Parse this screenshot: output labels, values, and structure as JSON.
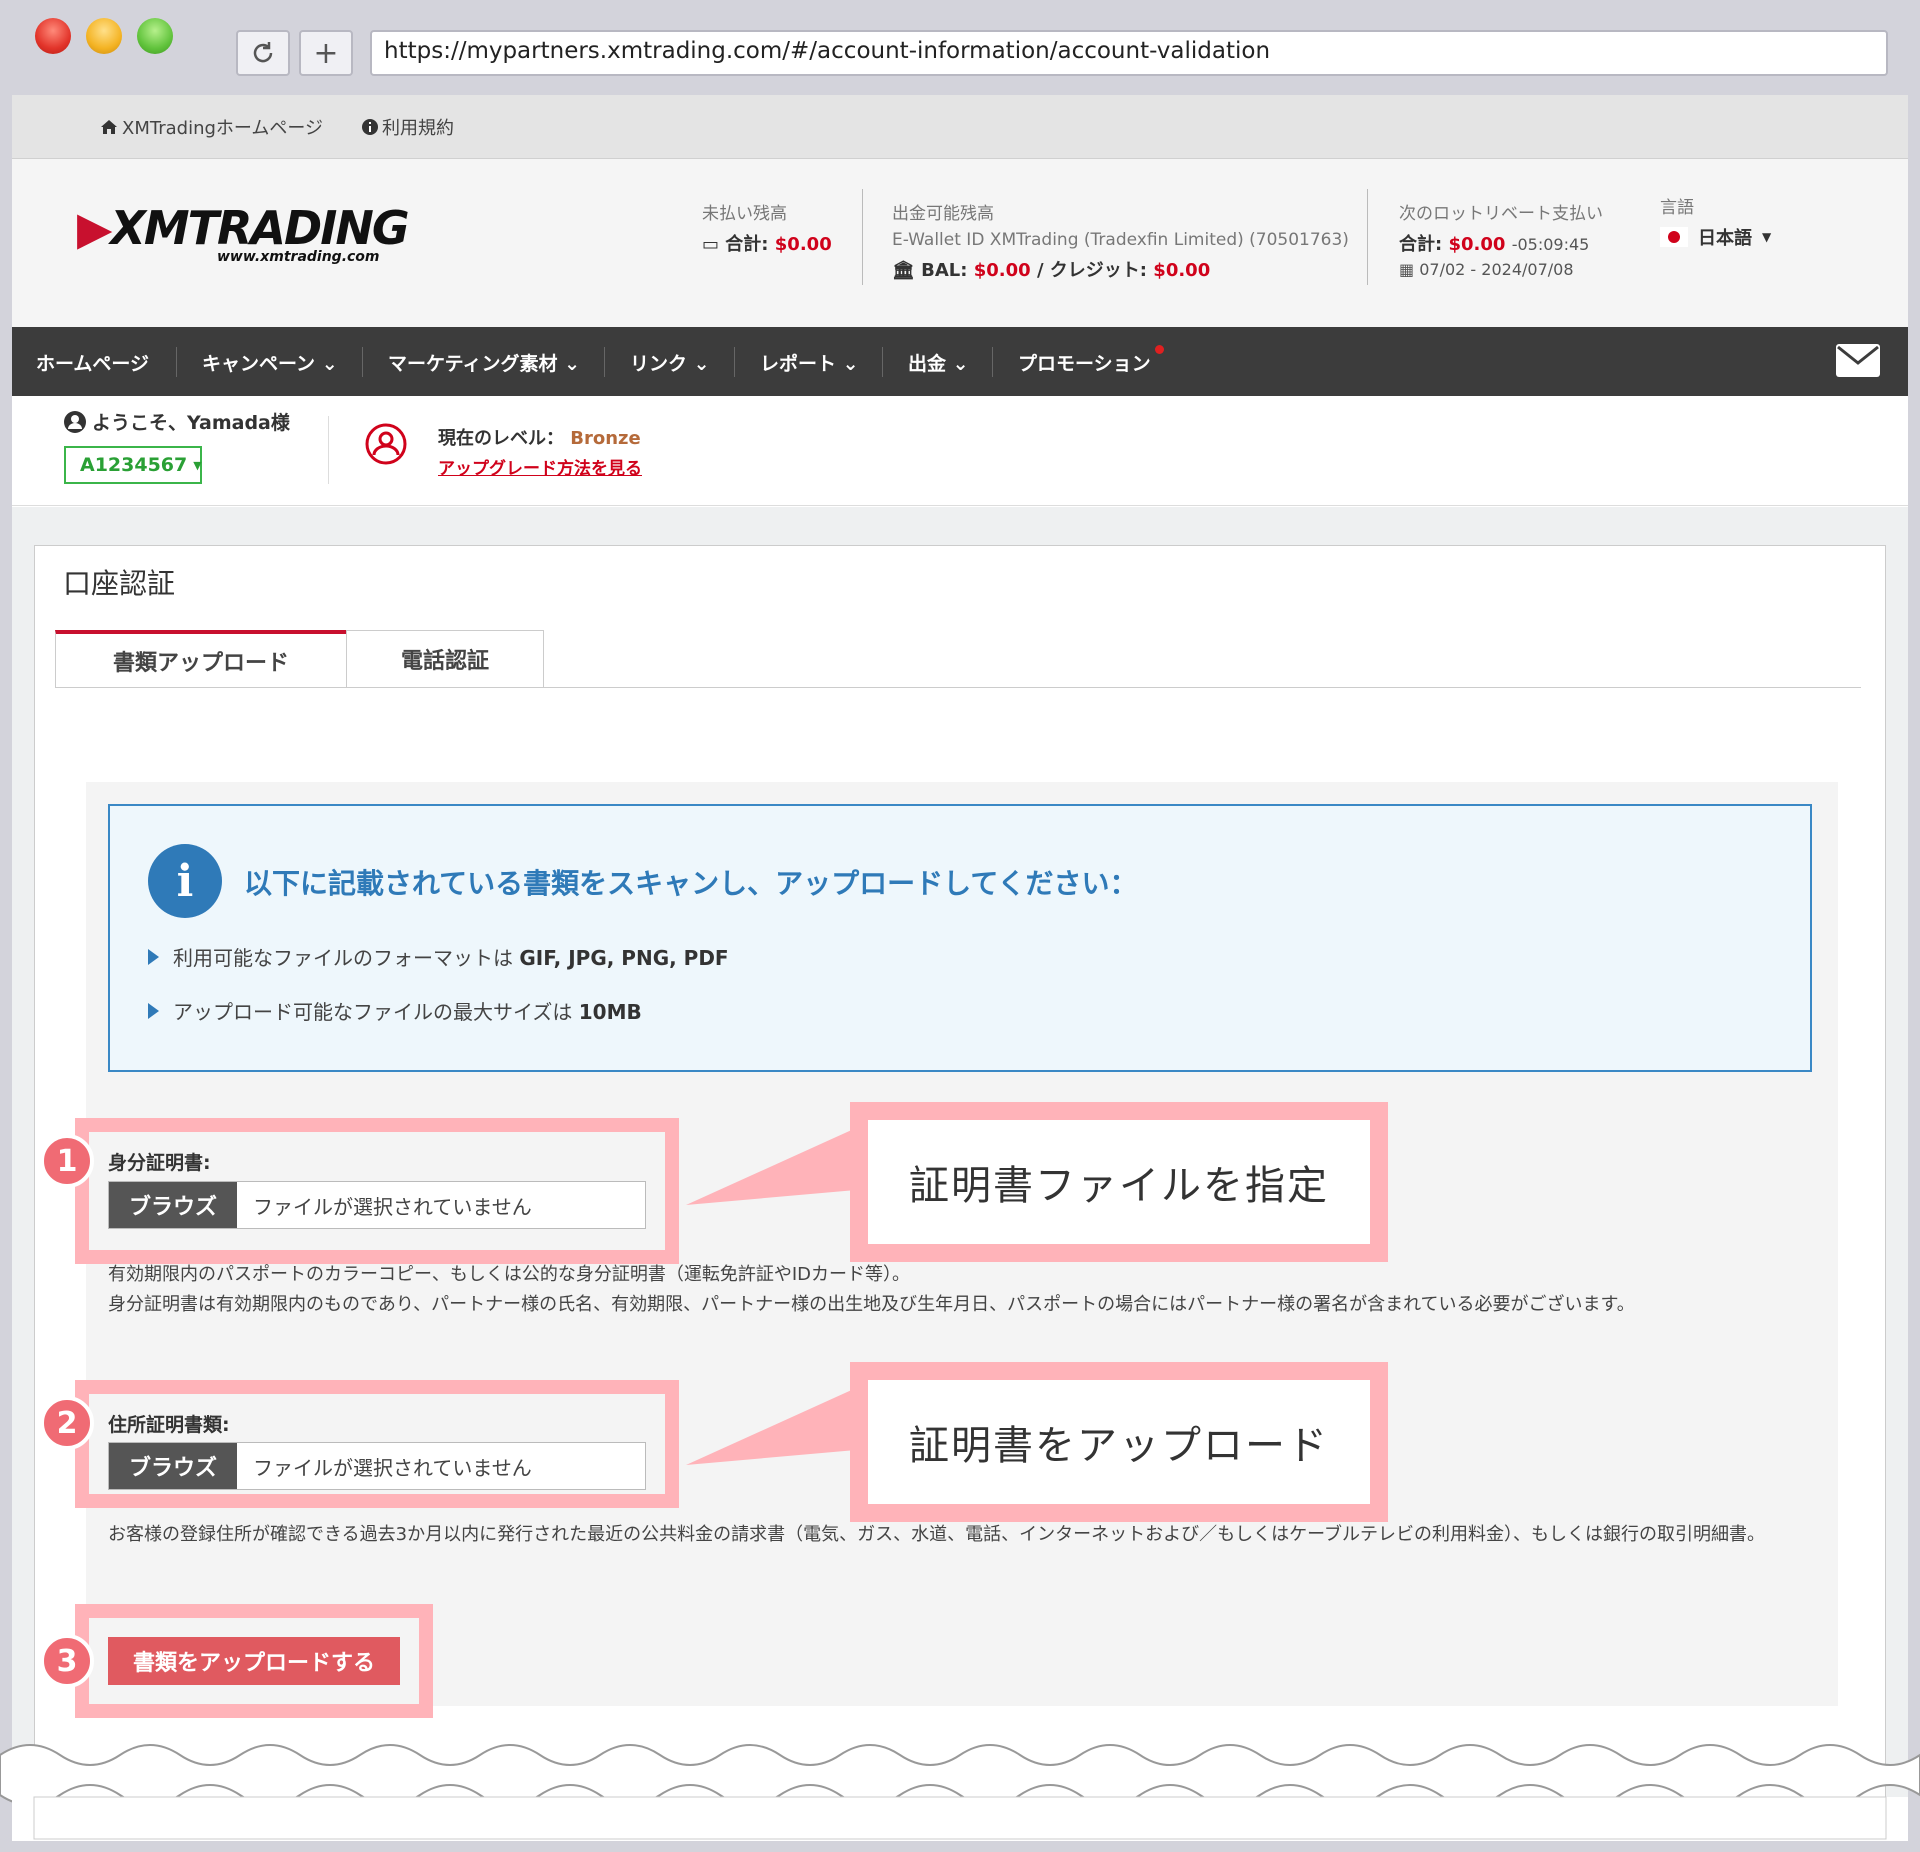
{
  "browser": {
    "url": "https://mypartners.xmtrading.com/#/account-information/account-validation"
  },
  "topbar": {
    "home_link": "XMTradingホームページ",
    "terms_link": "利用規約"
  },
  "header": {
    "logo_text": "XMTRADING",
    "logo_sub": "www.xmtrading.com",
    "unpaid": {
      "label": "未払い残高",
      "total_label": "合計:",
      "total_value": "$0.00"
    },
    "withdrawable": {
      "label": "出金可能残高",
      "wallet": "E-Wallet ID XMTrading (Tradexfin Limited) (70501763)",
      "bal_label": "BAL:",
      "bal_value": "$0.00",
      "credit_label": "/ クレジット:",
      "credit_value": "$0.00"
    },
    "rebate": {
      "label": "次のロットリベート支払い",
      "total_label": "合計:",
      "total_value": "$0.00",
      "countdown": "-05:09:45",
      "period": "07/02 - 2024/07/08"
    },
    "language": {
      "label": "言語",
      "value": "日本語"
    }
  },
  "nav": {
    "items": [
      "ホームページ",
      "キャンペーン",
      "マーケティング素材",
      "リンク",
      "レポート",
      "出金",
      "プロモーション"
    ]
  },
  "welcome": {
    "greeting": "ようこそ、Yamada様",
    "account_id": "A1234567",
    "level_label": "現在のレベル：",
    "level_value": "Bronze",
    "upgrade_link": "アップグレード方法を見る"
  },
  "panel": {
    "title": "口座認証",
    "tabs": [
      "書類アップロード",
      "電話認証"
    ],
    "info": {
      "title": "以下に記載されている書類をスキャンし、アップロードしてください：",
      "formats_text": "利用可能なファイルのフォーマットは",
      "formats_value": "GIF, JPG, PNG, PDF",
      "size_text": "アップロード可能なファイルの最大サイズは",
      "size_value": "10MB"
    },
    "id_doc": {
      "label": "身分証明書:",
      "browse": "ブラウズ",
      "no_file": "ファイルが選択されていません",
      "desc1": "有効期限内のパスポートのカラーコピー、もしくは公的な身分証明書（運転免許証やIDカード等）。",
      "desc2": "身分証明書は有効期限内のものであり、パートナー様の氏名、有効期限、パートナー様の出生地及び生年月日、パスポートの場合にはパートナー様の署名が含まれている必要がございます。"
    },
    "address_doc": {
      "label": "住所証明書類:",
      "browse": "ブラウズ",
      "no_file": "ファイルが選択されていません",
      "desc": "お客様の登録住所が確認できる過去3か月以内に発行された最近の公共料金の請求書（電気、ガス、水道、電話、インターネットおよび／もしくはケーブルテレビの利用料金）、もしくは銀行の取引明細書。"
    },
    "submit": "書類をアップロードする"
  },
  "annotations": {
    "num1": "1",
    "num2": "2",
    "num3": "3",
    "callout1": "証明書ファイルを指定",
    "callout2": "証明書をアップロード"
  }
}
